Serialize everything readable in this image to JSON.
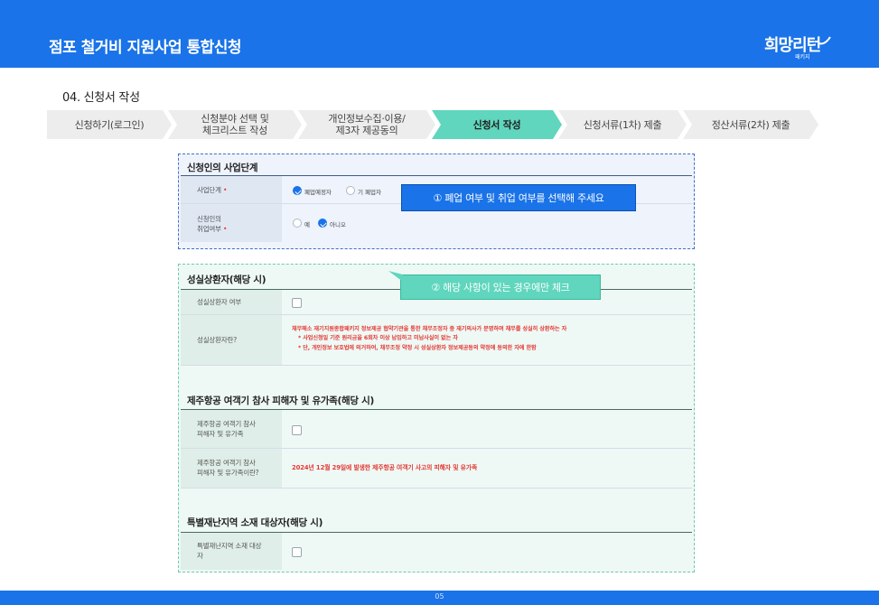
{
  "header": {
    "title": "점포 철거비 지원사업 통합신청",
    "logo_text": "희망리턴",
    "logo_sub": "패키지"
  },
  "step_title": "04. 신청서 작성",
  "steps": [
    {
      "label": "신청하기(로그인)",
      "active": false
    },
    {
      "label": "신청분야 선택 및\n체크리스트 작성",
      "active": false
    },
    {
      "label": "개인정보수집·이용/\n제3자 제공동의",
      "active": false
    },
    {
      "label": "신청서 작성",
      "active": true
    },
    {
      "label": "신청서류(1차) 제출",
      "active": false
    },
    {
      "label": "정산서류(2차) 제출",
      "active": false
    }
  ],
  "section1": {
    "title": "신청인의 사업단계",
    "business_stage": {
      "label": "사업단계",
      "required_mark": "•",
      "options": [
        "폐업예정자",
        "기 폐업자"
      ],
      "selected": "폐업예정자"
    },
    "employment": {
      "label": "신청인의\n취업여부",
      "required_mark": "•",
      "options": [
        "예",
        "아니오"
      ],
      "selected": "아니오"
    }
  },
  "tooltip1": "① 폐업 여부 및 취업 여부를 선택해 주세요",
  "tooltip2": "② 해당 사항이 있는 경우에만 체크",
  "section2": {
    "title": "성실상환자(해당 시)",
    "row1_label": "성실상환자 여부",
    "row2_label": "성실상환자란?",
    "definition": [
      "채무해소 재기지원종합패키지 정보제공 협약기관을 통한 채무조정자 중 재기의사가 분명하며 채무를 성실히 상환하는 자",
      "* 사업신청일 기준 원리금을 6회차 이상 납입하고 미납사실이 없는 자",
      "* 단, 개인정보 보호법에 의거하여, 채무조정 약정 시 성실상환자 정보제공동의 약정에 동의한 자에 한함"
    ]
  },
  "section3": {
    "title": "제주항공 여객기 참사 피해자 및 유가족(해당 시)",
    "row1_label": "제주항공 여객기 참사\n피해자 및 유가족",
    "row2_label": "제주항공 여객기 참사\n피해자 및 유가족이란?",
    "definition": "2024년 12월 29일에 발생한 제주항공 여객기 사고의 피해자 및 유가족"
  },
  "section4": {
    "title": "특별재난지역 소재 대상자(해당 시)",
    "row1_label": "특별재난지역 소재 대상\n자"
  },
  "footer": {
    "page": "05"
  },
  "colors": {
    "primary": "#1a73e8",
    "step_active": "#5fd6bd",
    "step_inactive": "#ededed",
    "required": "#e53935"
  }
}
